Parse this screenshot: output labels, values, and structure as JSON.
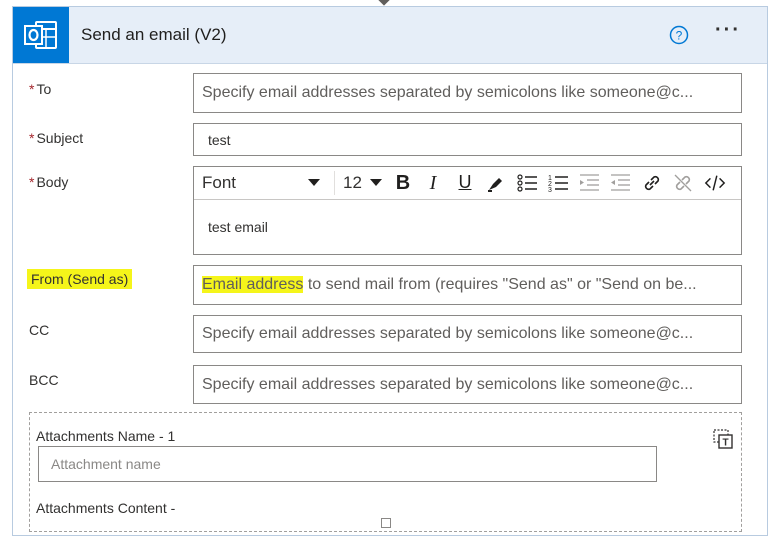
{
  "header": {
    "title": "Send an email (V2)",
    "app_icon": "outlook-icon",
    "help_icon": "question-circle-icon",
    "more_label": "···"
  },
  "fields": {
    "to": {
      "required_mark": "*",
      "label": "To",
      "placeholder": "Specify email addresses separated by semicolons like someone@c..."
    },
    "subject": {
      "required_mark": "*",
      "label": "Subject",
      "value": "test"
    },
    "body": {
      "required_mark": "*",
      "label": "Body",
      "value": "test email"
    },
    "from": {
      "label": "From (Send as)",
      "placeholder_highlighted": "Email address",
      "placeholder_rest": " to send mail from (requires \"Send as\" or \"Send on be..."
    },
    "cc": {
      "label": "CC",
      "placeholder": "Specify email addresses separated by semicolons like someone@c..."
    },
    "bcc": {
      "label": "BCC",
      "placeholder": "Specify email addresses separated by semicolons like someone@c..."
    }
  },
  "toolbar": {
    "font_label": "Font",
    "size_label": "12",
    "bold_label": "B",
    "italic_label": "I",
    "underline_label": "U"
  },
  "attachments": {
    "name_label": "Attachments Name - 1",
    "name_placeholder": "Attachment name",
    "content_label": "Attachments Content -"
  },
  "colors": {
    "brand": "#0078d4",
    "header_bg": "#e6eef8",
    "highlight": "#f5f51a",
    "required": "#a4262c"
  }
}
